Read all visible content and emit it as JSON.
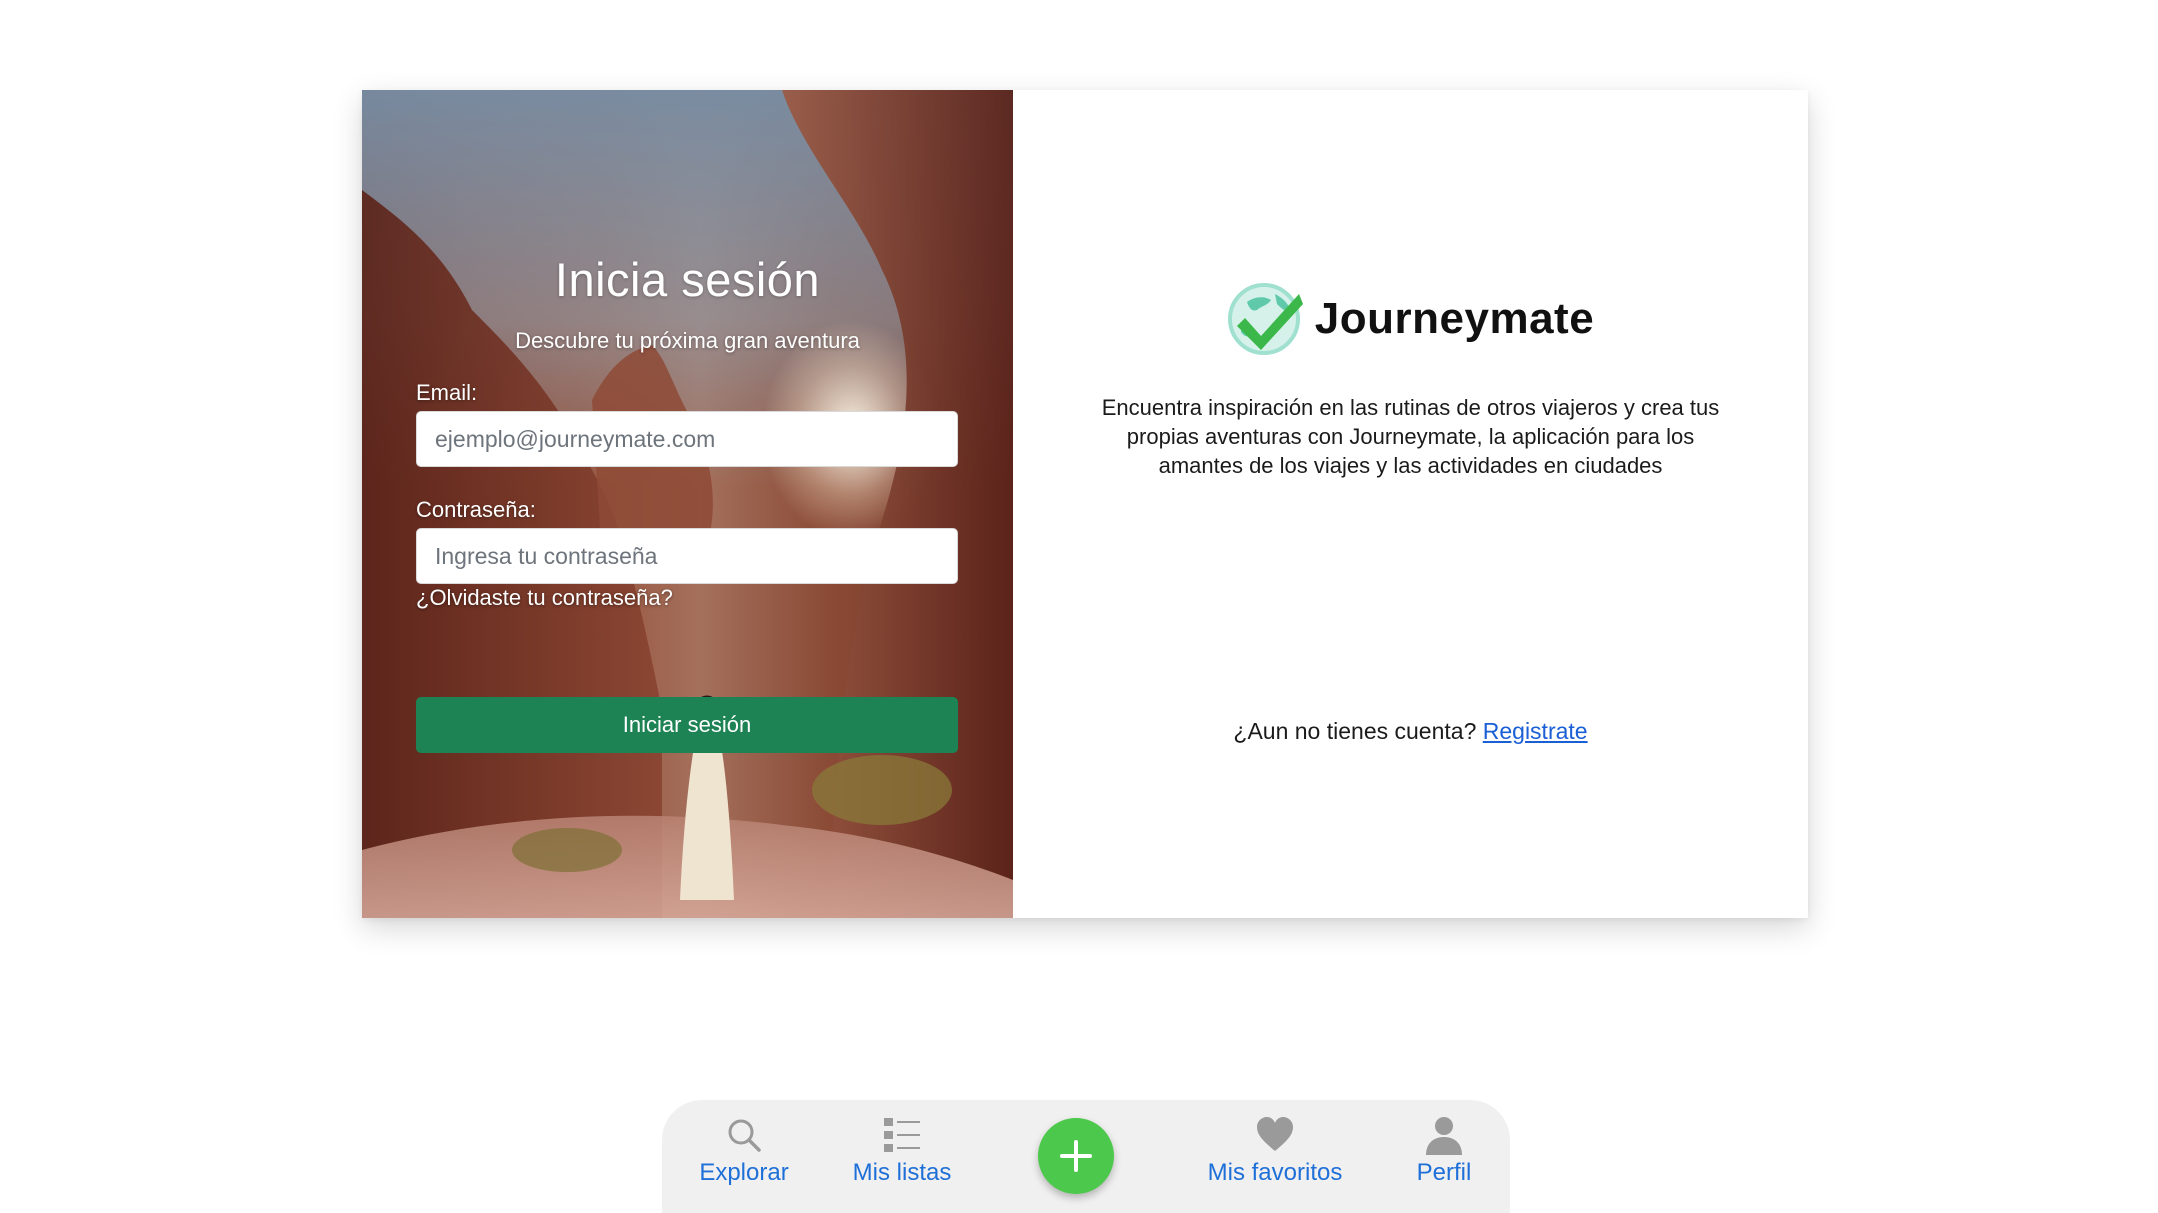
{
  "login": {
    "title": "Inicia sesión",
    "subtitle": "Descubre tu próxima gran aventura",
    "email_label": "Email:",
    "email_placeholder": "ejemplo@journeymate.com",
    "password_label": "Contraseña:",
    "password_placeholder": "Ingresa tu contraseña",
    "forgot_password": "¿Olvidaste tu contraseña?",
    "submit_label": "Iniciar sesión"
  },
  "brand": {
    "name": "Journeymate",
    "logo_icon": "globe-check-icon",
    "tagline": "Encuentra inspiración en las rutinas de otros viajeros y crea tus propias aventuras con Journeymate, la aplicación para los amantes de los viajes y las actividades en ciudades",
    "signup_prompt": "¿Aun no tienes cuenta?",
    "signup_link": "Registrate"
  },
  "bottom_nav": {
    "items": [
      {
        "label": "Explorar",
        "icon": "search-icon"
      },
      {
        "label": "Mis listas",
        "icon": "list-icon"
      },
      {
        "label": "",
        "icon": "plus-icon"
      },
      {
        "label": "Mis favoritos",
        "icon": "heart-icon"
      },
      {
        "label": "Perfil",
        "icon": "user-icon"
      }
    ]
  },
  "colors": {
    "primary_button": "#1e8354",
    "link": "#1a5fd6",
    "add_button": "#4cc94c",
    "nav_background": "#f0f0f0",
    "nav_icon": "#9a9a9a"
  }
}
